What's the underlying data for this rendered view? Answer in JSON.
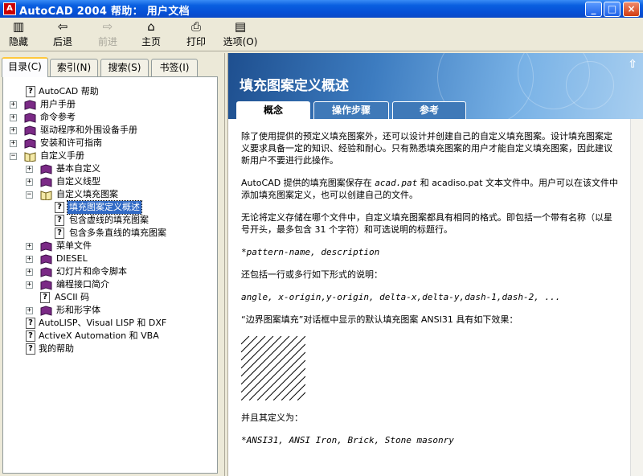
{
  "window": {
    "title": "AutoCAD 2004 帮助： 用户文档",
    "buttons": {
      "min": "_",
      "max": "□",
      "close": "×"
    }
  },
  "toolbar": {
    "hide": "隐藏",
    "back": "后退",
    "forward": "前进",
    "home": "主页",
    "print": "打印",
    "options": "选项(O)",
    "icons": {
      "hide": "hide-icon",
      "back": "back-arrow-icon",
      "forward": "forward-arrow-icon",
      "home": "home-icon",
      "print": "printer-icon",
      "options": "options-icon"
    }
  },
  "nav_tabs": [
    "目录(C)",
    "索引(N)",
    "搜索(S)",
    "书签(I)"
  ],
  "tree": {
    "autocad_help": "AutoCAD 帮助",
    "user_manual": "用户手册",
    "command_ref": "命令参考",
    "drivers": "驱动程序和外围设备手册",
    "install": "安装和许可指南",
    "custom_manual": "自定义手册",
    "basic_custom": "基本自定义",
    "custom_linetype": "自定义线型",
    "custom_hatch": "自定义填充图案",
    "hatch_overview": "填充图案定义概述",
    "dashed_hatch": "包含虚线的填充图案",
    "multi_line_hatch": "包含多条直线的填充图案",
    "menu_files": "菜单文件",
    "diesel": "DIESEL",
    "slides": "幻灯片和命令脚本",
    "prog_intro": "编程接口简介",
    "ascii": "ASCII 码",
    "shapes": "形和形字体",
    "autolisp": "AutoLISP、Visual LISP 和 DXF",
    "activex": "ActiveX Automation 和 VBA",
    "my_help": "我的帮助"
  },
  "content": {
    "heading": "填充图案定义概述",
    "tabs": [
      "概念",
      "操作步骤",
      "参考"
    ],
    "p1": "除了使用提供的预定义填充图案外，还可以设计并创建自己的自定义填充图案。设计填充图案定义要求具备一定的知识、经验和耐心。只有熟悉填充图案的用户才能自定义填充图案，因此建议新用户不要进行此操作。",
    "p2a": "AutoCAD 提供的填充图案保存在 ",
    "p2file": "acad.pat",
    "p2b": " 和 acadiso.pat 文本文件中。用户可以在该文件中添加填充图案定义，也可以创建自己的文件。",
    "p3": "无论将定义存储在哪个文件中，自定义填充图案都具有相同的格式。即包括一个带有名称（以星号开头，最多包含 31 个字符）和可选说明的标题行。",
    "code1": "*pattern-name, description",
    "p4": "还包括一行或多行如下形式的说明：",
    "code2": "angle, x-origin,y-origin, delta-x,delta-y,dash-1,dash-2, ...",
    "p5": "“边界图案填充”对话框中显示的默认填充图案 ANSI31 具有如下效果：",
    "p6": "并且其定义为：",
    "code3": "*ANSI31, ANSI Iron, Brick, Stone masonry"
  }
}
